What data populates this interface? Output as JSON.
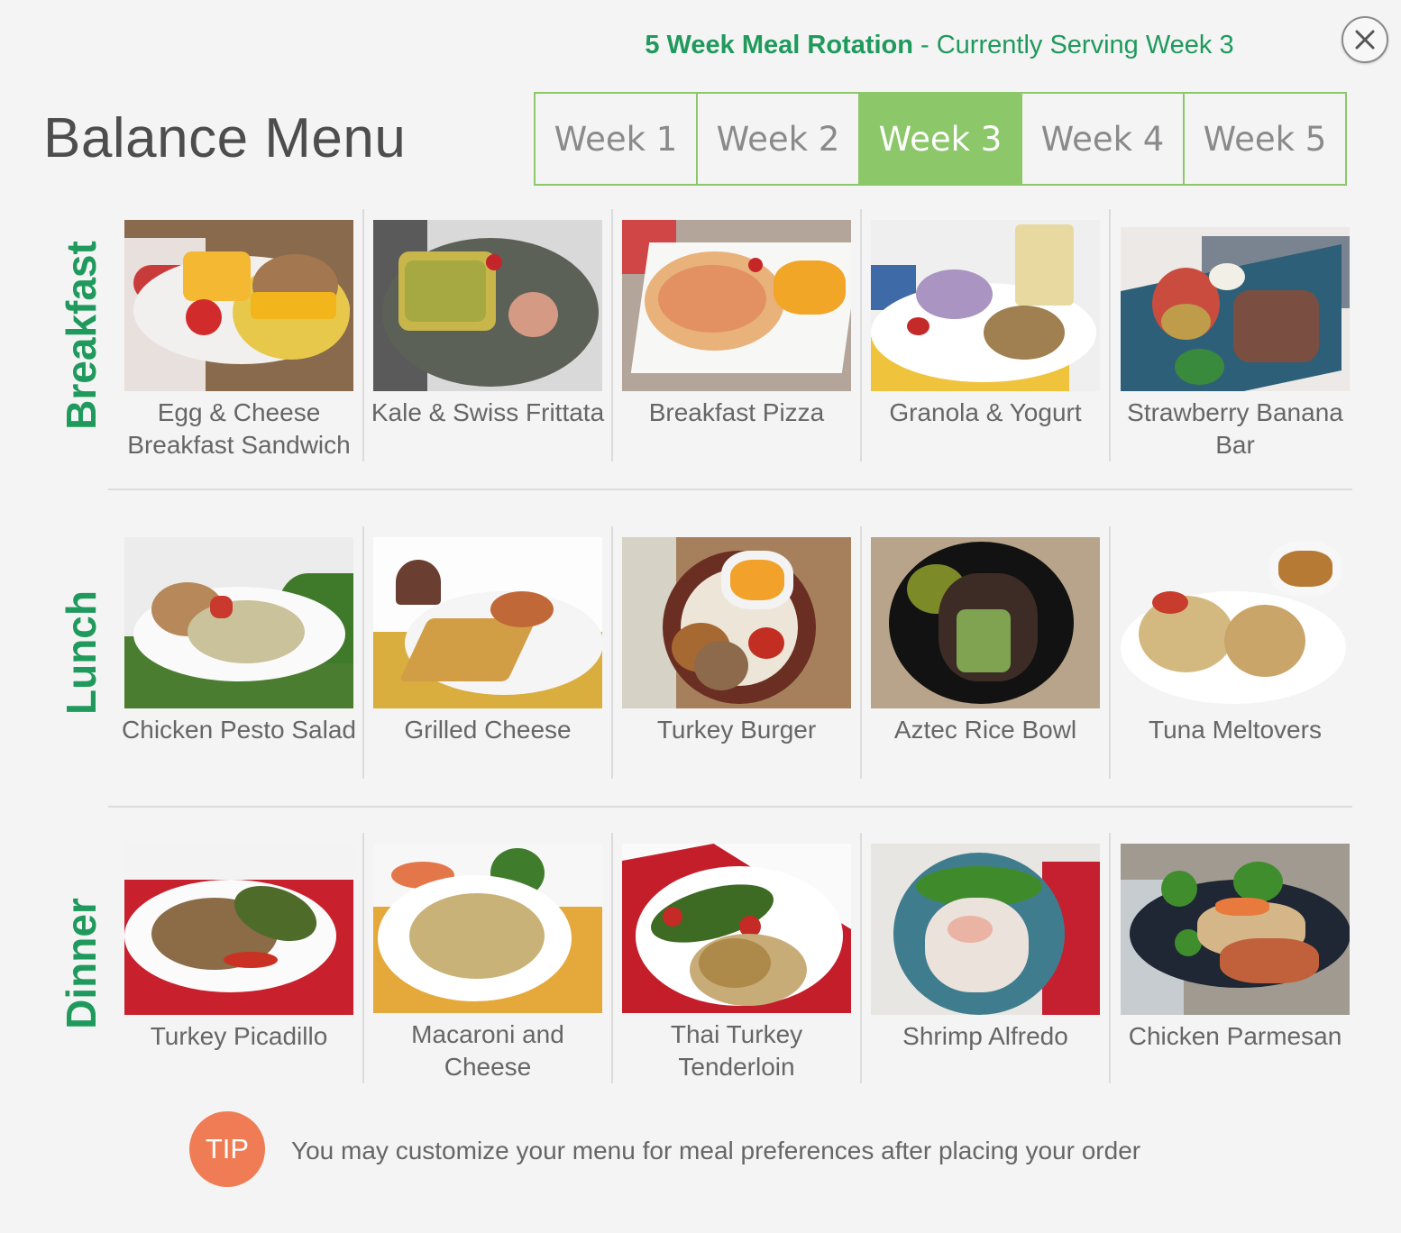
{
  "header": {
    "rotation_bold": "5 Week Meal Rotation",
    "rotation_rest": " - Currently Serving Week 3",
    "close_label": "close"
  },
  "page_title": "Balance Menu",
  "weeks": [
    {
      "label": "Week 1",
      "active": false
    },
    {
      "label": "Week 2",
      "active": false
    },
    {
      "label": "Week 3",
      "active": true
    },
    {
      "label": "Week 4",
      "active": false
    },
    {
      "label": "Week 5",
      "active": false
    }
  ],
  "meals": [
    {
      "label": "Breakfast",
      "items": [
        {
          "name": "Egg & Cheese Breakfast Sandwich",
          "photo": "egg-cheese-sandwich"
        },
        {
          "name": "Kale & Swiss Frittata",
          "photo": "kale-frittata"
        },
        {
          "name": "Breakfast Pizza",
          "photo": "breakfast-pizza"
        },
        {
          "name": "Granola & Yogurt",
          "photo": "granola-yogurt"
        },
        {
          "name": "Strawberry Banana Bar",
          "photo": "strawberry-banana-bar"
        }
      ]
    },
    {
      "label": "Lunch",
      "items": [
        {
          "name": "Chicken Pesto Salad",
          "photo": "chicken-pesto-salad"
        },
        {
          "name": "Grilled Cheese",
          "photo": "grilled-cheese"
        },
        {
          "name": "Turkey Burger",
          "photo": "turkey-burger"
        },
        {
          "name": "Aztec Rice Bowl",
          "photo": "aztec-rice-bowl"
        },
        {
          "name": "Tuna Meltovers",
          "photo": "tuna-meltovers"
        }
      ]
    },
    {
      "label": "Dinner",
      "items": [
        {
          "name": "Turkey Picadillo",
          "photo": "turkey-picadillo"
        },
        {
          "name": "Macaroni and Cheese",
          "photo": "macaroni-cheese"
        },
        {
          "name": "Thai Turkey Tenderloin",
          "photo": "thai-turkey-tenderloin"
        },
        {
          "name": "Shrimp Alfredo",
          "photo": "shrimp-alfredo"
        },
        {
          "name": "Chicken Parmesan",
          "photo": "chicken-parmesan"
        }
      ]
    }
  ],
  "tip": {
    "badge": "TIP",
    "text": "You may customize your menu for meal preferences after placing your order"
  },
  "colors": {
    "brand_green": "#1f9a5c",
    "tab_green": "#8cc76a",
    "tip_orange": "#f07c55",
    "text_gray": "#666666"
  }
}
